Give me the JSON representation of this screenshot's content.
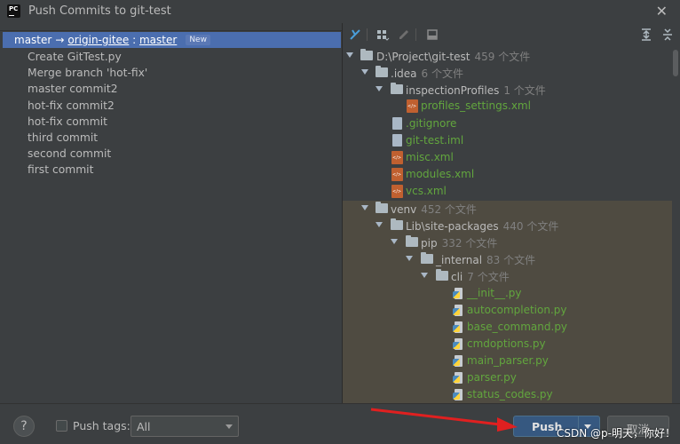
{
  "window": {
    "title": "Push Commits to git-test",
    "close_symbol": "✕"
  },
  "branch": {
    "local": "master",
    "arrow": "→",
    "remote": "origin-gitee",
    "separator": " : ",
    "remote_branch": "master",
    "badge": "New"
  },
  "commits": [
    "Create GitTest.py",
    "Merge branch 'hot-fix'",
    "master commit2",
    "hot-fix commit2",
    "hot-fix commit",
    "third commit",
    "second commit",
    "first commit"
  ],
  "tree": {
    "root": {
      "name": "D:\\Project\\git-test",
      "count": "459 个文件"
    },
    "idea": {
      "name": ".idea",
      "count": "6 个文件"
    },
    "inspection": {
      "name": "inspectionProfiles",
      "count": "1 个文件"
    },
    "profiles": "profiles_settings.xml",
    "gitignore": ".gitignore",
    "iml": "git-test.iml",
    "misc": "misc.xml",
    "modules": "modules.xml",
    "vcs": "vcs.xml",
    "venv": {
      "name": "venv",
      "count": "452 个文件"
    },
    "sitepkg": {
      "name": "Lib\\site-packages",
      "count": "440 个文件"
    },
    "pip": {
      "name": "pip",
      "count": "332 个文件"
    },
    "internal": {
      "name": "_internal",
      "count": "83 个文件"
    },
    "cli": {
      "name": "cli",
      "count": "7 个文件"
    },
    "cli_files": [
      "__init__.py",
      "autocompletion.py",
      "base_command.py",
      "cmdoptions.py",
      "main_parser.py",
      "parser.py",
      "status_codes.py"
    ]
  },
  "footer": {
    "help": "?",
    "push_tags_label": "Push tags:",
    "push_tags_value": "All",
    "push_label": "Push",
    "cancel_label": "取消",
    "watermark": "CSDN @p-明天，你好！"
  },
  "colors": {
    "selection": "#4b6eaf",
    "file_green": "#62a63e",
    "push_button": "#365880",
    "annotation": "#e02020"
  }
}
